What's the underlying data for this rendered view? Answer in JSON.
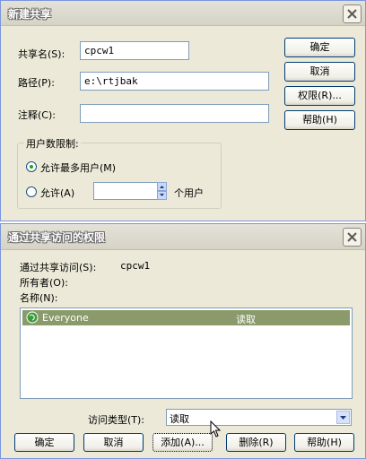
{
  "dialog1": {
    "title": "新建共享",
    "share_name_label": "共享名(S):",
    "share_name_value": "cpcw1",
    "path_label": "路径(P):",
    "path_value": "e:\\rtjbak",
    "comment_label": "注释(C):",
    "comment_value": "",
    "ok_label": "确定",
    "cancel_label": "取消",
    "permissions_label": "权限(R)...",
    "help_label": "帮助(H)",
    "user_limit_group": "用户数限制:",
    "max_users_label": "允许最多用户(M)",
    "allow_label": "允许(A)",
    "allow_count": "",
    "users_suffix": "个用户",
    "max_users_selected": true
  },
  "dialog2": {
    "title": "通过共享访问的权限",
    "access_via_label": "通过共享访问(S):",
    "access_via_value": "cpcw1",
    "owner_label": "所有者(O):",
    "owner_value": "",
    "names_label": "名称(N):",
    "entries": [
      {
        "icon": "globe-icon",
        "name": "Everyone",
        "permission": "读取"
      }
    ],
    "access_type_label": "访问类型(T):",
    "access_type_value": "读取",
    "ok_label": "确定",
    "cancel_label": "取消",
    "add_label": "添加(A)...",
    "remove_label": "删除(R)",
    "help_label": "帮助(H)"
  }
}
